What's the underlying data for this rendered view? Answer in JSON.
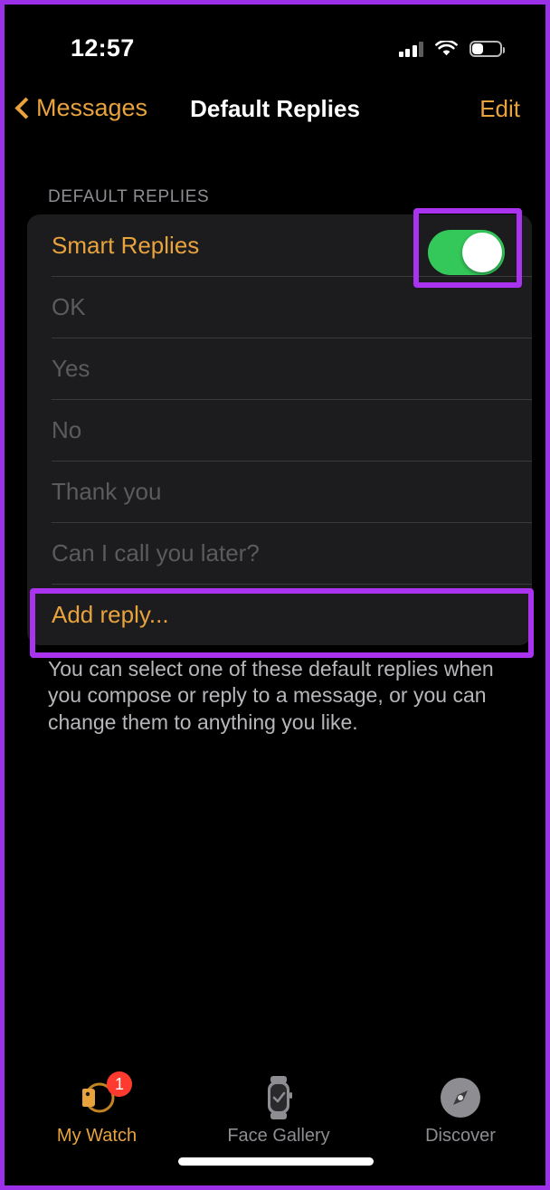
{
  "status_bar": {
    "time": "12:57",
    "signal_icon": "cellular-signal-icon",
    "wifi_icon": "wifi-icon",
    "battery_icon": "battery-icon",
    "battery_level_percent": 30
  },
  "nav_bar": {
    "back_icon": "chevron-left-icon",
    "back_label": "Messages",
    "title": "Default Replies",
    "edit_label": "Edit"
  },
  "section": {
    "header": "DEFAULT REPLIES",
    "smart_replies": {
      "label": "Smart Replies",
      "toggle_state": "on"
    },
    "replies": [
      {
        "text": "OK"
      },
      {
        "text": "Yes"
      },
      {
        "text": "No"
      },
      {
        "text": "Thank you"
      },
      {
        "text": "Can I call you later?"
      }
    ],
    "add_reply_label": "Add reply...",
    "footer_note": "You can select one of these default replies when you compose or reply to a message, or you can change them to anything you like."
  },
  "tab_bar": {
    "tabs": [
      {
        "label": "My Watch",
        "icon": "apple-watch-side-icon",
        "active": true,
        "badge": "1"
      },
      {
        "label": "Face Gallery",
        "icon": "watch-face-check-icon",
        "active": false
      },
      {
        "label": "Discover",
        "icon": "compass-icon",
        "active": false
      }
    ]
  },
  "colors": {
    "accent_orange": "#e8a33d",
    "toggle_green": "#34c759",
    "badge_red": "#ff3b30",
    "annotation_purple": "#a933ee",
    "card_background": "#1c1c1e",
    "page_background": "#000000",
    "dim_text": "#5b5b5e"
  },
  "annotations": [
    {
      "target": "smart-replies-toggle",
      "color": "#a933ee"
    },
    {
      "target": "add-reply-row",
      "color": "#a933ee"
    }
  ]
}
